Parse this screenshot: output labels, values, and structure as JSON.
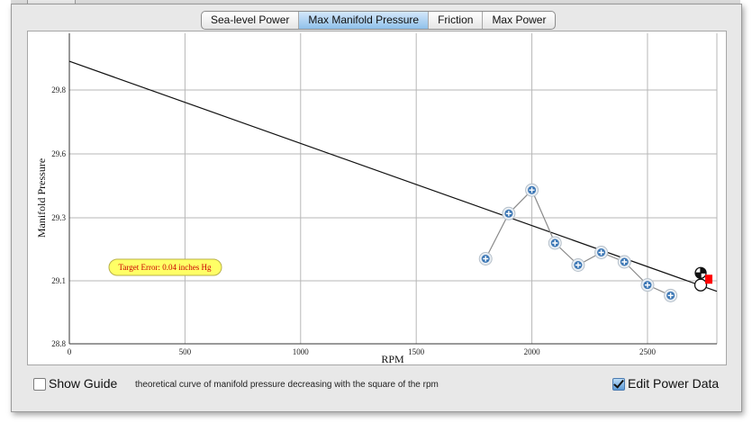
{
  "tabs": [
    {
      "label": "Sea-level Power",
      "active": false
    },
    {
      "label": "Max Manifold Pressure",
      "active": true
    },
    {
      "label": "Friction",
      "active": false
    },
    {
      "label": "Max Power",
      "active": false
    }
  ],
  "target_error": "Target Error: 0.04 inches Hg",
  "show_guide": {
    "label": "Show Guide",
    "checked": false
  },
  "guide_description": "theoretical curve of manifold pressure decreasing with the square of the rpm",
  "edit_power_data": {
    "label": "Edit Power Data",
    "checked": true
  },
  "colors": {
    "active_tab": "#9cc8ee",
    "point_fill": "#3c77b5",
    "tooltip_bg": "#ffff66",
    "tooltip_text": "#cc0000",
    "marker_red": "#ff0000"
  },
  "chart_data": {
    "type": "scatter",
    "xlabel": "RPM",
    "ylabel": "Manifold Pressure",
    "xlim": [
      0,
      2800
    ],
    "ylim": [
      28.8,
      29.95
    ],
    "xticks": [
      0,
      500,
      1000,
      1500,
      2000,
      2500
    ],
    "yticks": [
      28.8,
      29.1,
      29.3,
      29.6,
      29.8
    ],
    "ytick_labels": [
      "28.8",
      "29.1",
      "29.3",
      "29.6",
      "29.8"
    ],
    "grid": true,
    "series": [
      {
        "points": [
          {
            "x": 1800,
            "y": 29.17
          },
          {
            "x": 1900,
            "y": 29.32
          },
          {
            "x": 2000,
            "y": 29.43
          },
          {
            "x": 2100,
            "y": 29.22
          },
          {
            "x": 2200,
            "y": 29.15
          },
          {
            "x": 2300,
            "y": 29.19
          },
          {
            "x": 2400,
            "y": 29.16
          },
          {
            "x": 2500,
            "y": 29.08
          },
          {
            "x": 2600,
            "y": 29.03
          }
        ]
      }
    ],
    "fit_line": [
      [
        0,
        29.89
      ],
      [
        2800,
        29.05
      ]
    ],
    "markers": [
      {
        "kind": "crosshair",
        "x": 2730,
        "y": 29.125
      },
      {
        "kind": "open-circle",
        "x": 2730,
        "y": 29.08
      },
      {
        "kind": "red-square",
        "x": 2765,
        "y": 29.105
      }
    ]
  }
}
